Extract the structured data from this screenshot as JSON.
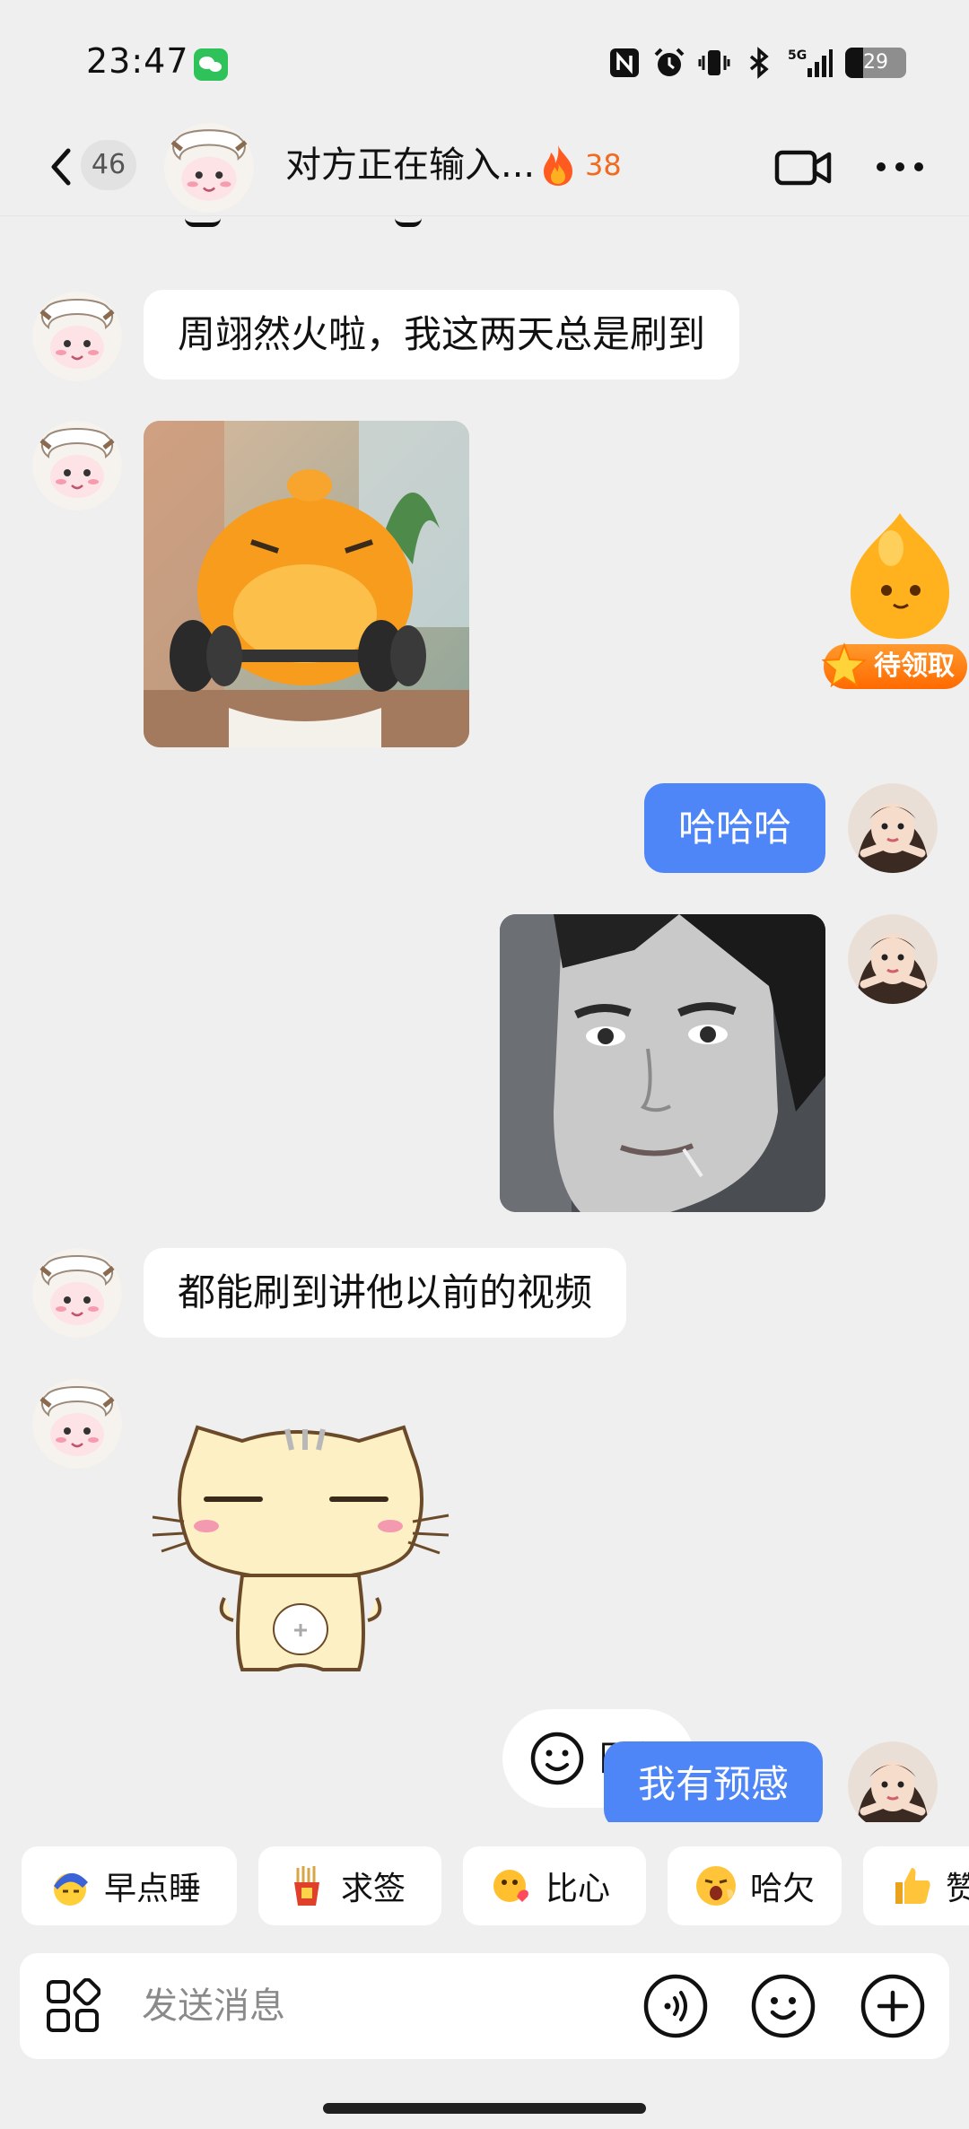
{
  "status_bar": {
    "time": "23:47",
    "battery": "29",
    "icons": [
      "wechat-notification-icon",
      "nfc-icon",
      "alarm-icon",
      "vibrate-icon",
      "bluetooth-icon",
      "signal-5g-icon",
      "battery-icon"
    ]
  },
  "nav": {
    "unread_count": "46",
    "title": "对方正在输入...",
    "streak_count": "38",
    "icons": [
      "back-arrow-icon",
      "fire-icon",
      "video-call-icon",
      "more-icon"
    ]
  },
  "floating_reward": {
    "label": "待领取"
  },
  "messages": [
    {
      "side": "in",
      "type": "text",
      "text": "周翊然火啦，我这两天总是刷到"
    },
    {
      "side": "in",
      "type": "image",
      "image": "orange-creature-lifting-dumbbells"
    },
    {
      "side": "out",
      "type": "text",
      "text": "哈哈哈"
    },
    {
      "side": "out",
      "type": "image",
      "image": "grayscale-animated-man-face"
    },
    {
      "side": "in",
      "type": "text",
      "text": "都能刷到讲他以前的视频"
    },
    {
      "side": "in",
      "type": "sticker",
      "image": "sleepy-cat-sticker"
    },
    {
      "side": "out",
      "type": "text",
      "text": "我有预感"
    }
  ],
  "reply_pill": {
    "label": "回复"
  },
  "quick_replies": [
    {
      "label": "早点睡",
      "icon": "sleep-icon"
    },
    {
      "label": "求签",
      "icon": "fortune-sticks-icon"
    },
    {
      "label": "比心",
      "icon": "heart-hands-icon"
    },
    {
      "label": "哈欠",
      "icon": "yawn-icon"
    },
    {
      "label": "赞",
      "icon": "thumbs-up-icon"
    }
  ],
  "input": {
    "placeholder": "发送消息",
    "value": ""
  },
  "colors": {
    "background": "#efefef",
    "outgoing_bubble": "#4f86f7",
    "incoming_bubble": "#ffffff",
    "streak": "#f06a1f"
  }
}
